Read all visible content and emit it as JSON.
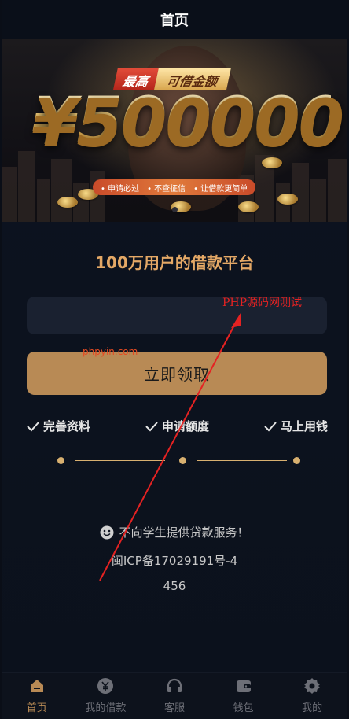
{
  "header": {
    "title": "首页"
  },
  "banner": {
    "tag_left": "最高",
    "tag_right": "可借金额",
    "amount": "¥500000",
    "slogans": [
      "申请必过",
      "不查征信",
      "让借款更简单"
    ]
  },
  "main": {
    "platform_title": "100万用户的借款平台",
    "input_placeholder": "",
    "claim_button": "立即领取",
    "steps": [
      "完善资料",
      "申请额度",
      "马上用钱"
    ],
    "notice": "不向学生提供贷款服务！",
    "icp": "闽ICP备17029191号-4",
    "extra_text": "456"
  },
  "watermarks": {
    "text1": "PHP源码网测试",
    "text2": "phpyin.com"
  },
  "tabbar": {
    "items": [
      {
        "label": "首页",
        "icon": "home-icon"
      },
      {
        "label": "我的借款",
        "icon": "yen-icon"
      },
      {
        "label": "客服",
        "icon": "headset-icon"
      },
      {
        "label": "钱包",
        "icon": "wallet-icon"
      },
      {
        "label": "我的",
        "icon": "gear-icon"
      }
    ]
  },
  "colors": {
    "accent": "#b88a55",
    "title_gold": "#e4a866",
    "background": "#0f1420",
    "watermark_red": "#e52222"
  }
}
